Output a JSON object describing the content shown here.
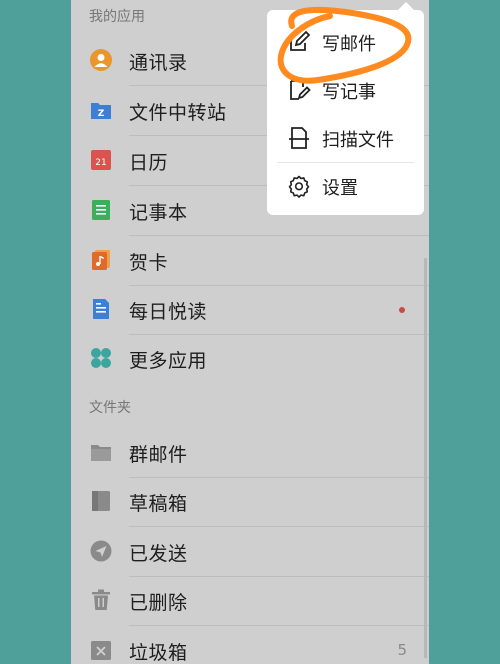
{
  "sections": {
    "apps_header": "我的应用",
    "folders_header": "文件夹"
  },
  "apps": [
    {
      "label": "通讯录",
      "icon": "contacts-icon"
    },
    {
      "label": "文件中转站",
      "icon": "file-transfer-icon"
    },
    {
      "label": "日历",
      "icon": "calendar-icon",
      "icon_text": "21"
    },
    {
      "label": "记事本",
      "icon": "notebook-icon"
    },
    {
      "label": "贺卡",
      "icon": "greeting-card-icon"
    },
    {
      "label": "每日悦读",
      "icon": "daily-reading-icon",
      "unread_dot": true
    },
    {
      "label": "更多应用",
      "icon": "more-apps-icon"
    }
  ],
  "folders": [
    {
      "label": "群邮件",
      "icon": "group-mail-folder-icon"
    },
    {
      "label": "草稿箱",
      "icon": "drafts-icon"
    },
    {
      "label": "已发送",
      "icon": "sent-icon"
    },
    {
      "label": "已删除",
      "icon": "trash-icon"
    },
    {
      "label": "垃圾箱",
      "icon": "spam-icon",
      "count": "5"
    }
  ],
  "menu": [
    {
      "label": "写邮件",
      "icon": "compose-edit-icon"
    },
    {
      "label": "写记事",
      "icon": "write-note-icon"
    },
    {
      "label": "扫描文件",
      "icon": "scan-document-icon"
    },
    {
      "label": "设置",
      "icon": "gear-icon"
    }
  ],
  "colors": {
    "background": "#4fa09b",
    "panel": "#cfcfcf",
    "annotation_circle": "#ff8a1f",
    "unread_dot": "#c44b4b"
  }
}
